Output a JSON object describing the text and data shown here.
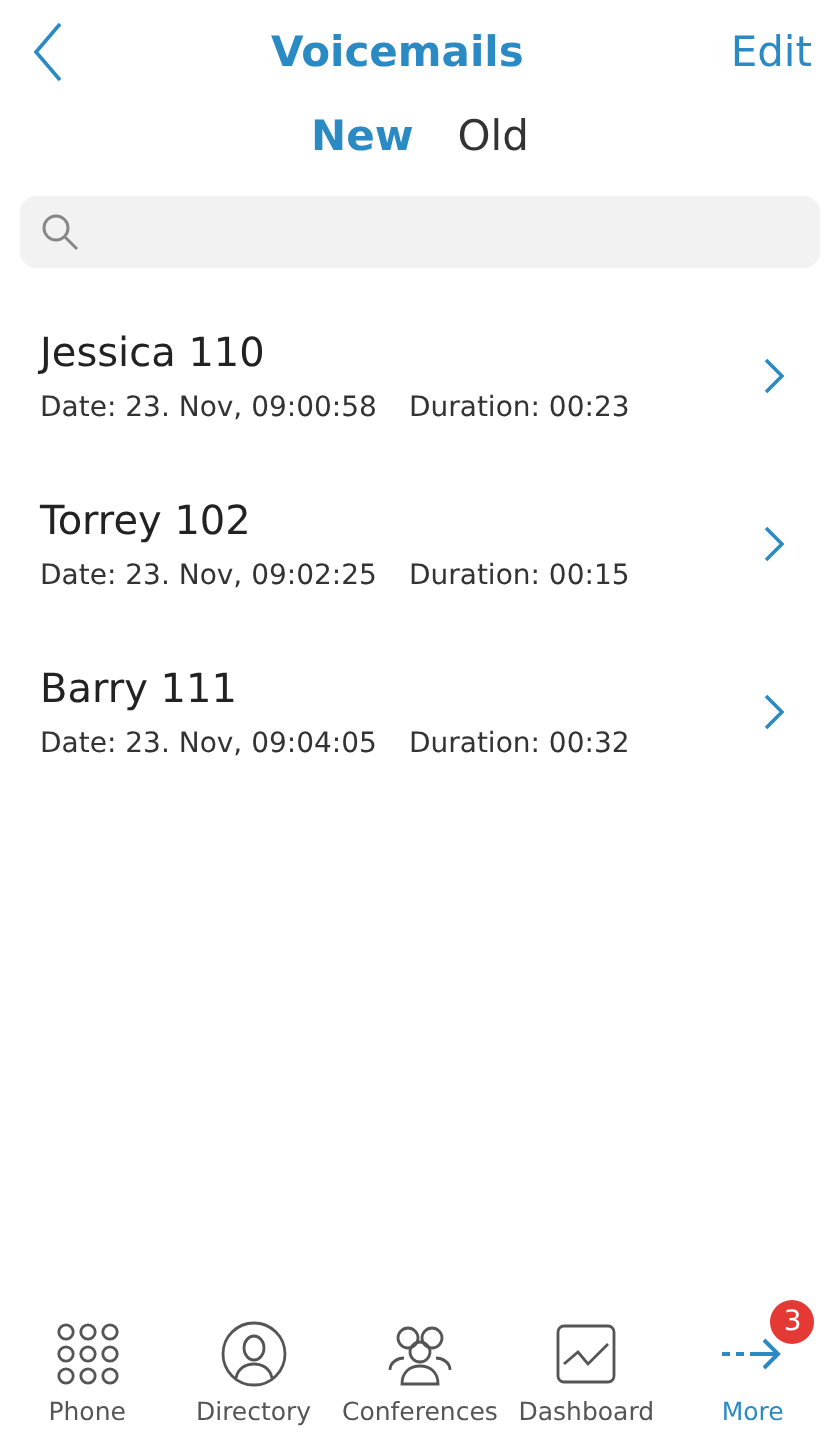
{
  "header": {
    "title": "Voicemails",
    "action": "Edit"
  },
  "segments": [
    {
      "label": "New",
      "selected": true
    },
    {
      "label": "Old",
      "selected": false
    }
  ],
  "voicemails": [
    {
      "name": "Jessica 110",
      "date": "Date: 23. Nov, 09:00:58",
      "duration": "Duration: 00:23"
    },
    {
      "name": "Torrey 102",
      "date": "Date: 23. Nov, 09:02:25",
      "duration": "Duration: 00:15"
    },
    {
      "name": "Barry 111",
      "date": "Date: 23. Nov, 09:04:05",
      "duration": "Duration: 00:32"
    }
  ],
  "tab_bar": [
    {
      "kind": "keypad",
      "label": "Phone",
      "selected": false
    },
    {
      "kind": "person",
      "label": "Directory",
      "selected": false
    },
    {
      "kind": "group",
      "label": "Conferences",
      "selected": false
    },
    {
      "kind": "chart",
      "label": "Dashboard",
      "selected": false
    },
    {
      "kind": "more",
      "label": "More",
      "selected": true,
      "badge": "3"
    }
  ]
}
